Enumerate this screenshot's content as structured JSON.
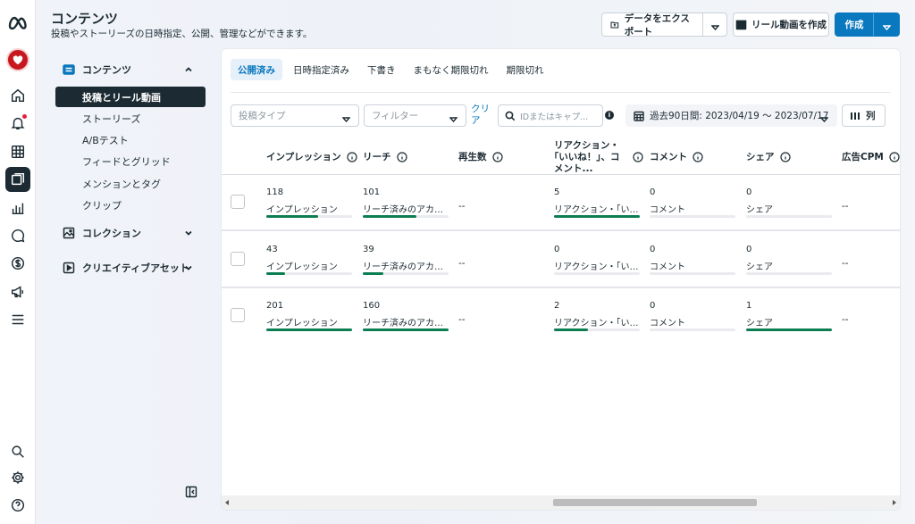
{
  "header": {
    "title": "コンテンツ",
    "subtitle": "投稿やストーリーズの日時指定、公開、管理などができます。",
    "export_label": "データをエクスポート",
    "reel_label": "リール動画を作成",
    "create_label": "作成"
  },
  "sidebar": {
    "groups": [
      {
        "label": "コンテンツ",
        "expanded": true
      },
      {
        "label": "コレクション",
        "expanded": false
      },
      {
        "label": "クリエイティブアセット",
        "expanded": false
      }
    ],
    "items": [
      {
        "label": "投稿とリール動画",
        "active": true
      },
      {
        "label": "ストーリーズ"
      },
      {
        "label": "A/Bテスト"
      },
      {
        "label": "フィードとグリッド"
      },
      {
        "label": "メンションとタグ"
      },
      {
        "label": "クリップ"
      }
    ]
  },
  "tabs": [
    "公開済み",
    "日時指定済み",
    "下書き",
    "まもなく期限切れ",
    "期限切れ"
  ],
  "filters": {
    "post_type_placeholder": "投稿タイプ",
    "filter_placeholder": "フィルター",
    "clear_label": "クリア",
    "search_placeholder": "IDまたはキャプ...",
    "date_range": "過去90日間: 2023/04/19 ～ 2023/07/17",
    "columns_label": "列"
  },
  "table": {
    "columns": [
      "インプレッション",
      "リーチ",
      "再生数",
      "リアクション・｢いいね！｣、コメント...",
      "コメント",
      "シェア",
      "広告CPM"
    ],
    "rows": [
      {
        "impressions": {
          "value": "118",
          "label": "インプレッション",
          "fill": 0.6
        },
        "reach": {
          "value": "101",
          "label": "リーチ済みのアカウン...",
          "fill": 0.63
        },
        "plays": "--",
        "reactions": {
          "value": "5",
          "label": "リアクション・「いい...",
          "fill": 1.0
        },
        "comments": {
          "value": "0",
          "label": "コメント",
          "fill": 0
        },
        "shares": {
          "value": "0",
          "label": "シェア",
          "fill": 0
        },
        "cpm": "--"
      },
      {
        "impressions": {
          "value": "43",
          "label": "インプレッション",
          "fill": 0.22
        },
        "reach": {
          "value": "39",
          "label": "リーチ済みのアカウン...",
          "fill": 0.24
        },
        "plays": "--",
        "reactions": {
          "value": "0",
          "label": "リアクション・「いい...",
          "fill": 0
        },
        "comments": {
          "value": "0",
          "label": "コメント",
          "fill": 0
        },
        "shares": {
          "value": "0",
          "label": "シェア",
          "fill": 0
        },
        "cpm": "--"
      },
      {
        "impressions": {
          "value": "201",
          "label": "インプレッション",
          "fill": 1.0
        },
        "reach": {
          "value": "160",
          "label": "リーチ済みのアカウン...",
          "fill": 1.0
        },
        "plays": "--",
        "reactions": {
          "value": "2",
          "label": "リアクション・「いい...",
          "fill": 0.4
        },
        "comments": {
          "value": "0",
          "label": "コメント",
          "fill": 0
        },
        "shares": {
          "value": "1",
          "label": "シェア",
          "fill": 1.0
        },
        "cpm": "--"
      }
    ]
  },
  "colors": {
    "accent": "#0a78be",
    "bar_fill": "#0b7e52",
    "active_nav": "#1c2b33"
  }
}
